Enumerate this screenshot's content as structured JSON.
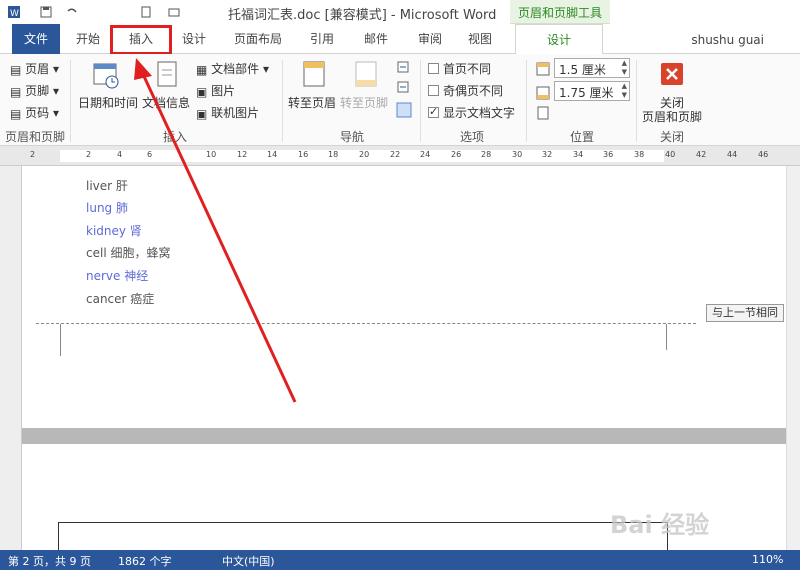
{
  "window": {
    "title": "托福词汇表.doc [兼容模式] - Microsoft Word",
    "context_tool": "页眉和页脚工具"
  },
  "tabs": [
    "文件",
    "开始",
    "插入",
    "设计",
    "页面布局",
    "引用",
    "邮件",
    "审阅",
    "视图",
    "设计"
  ],
  "user": "shushu guai",
  "ribbon": {
    "hf_group": {
      "header": "页眉",
      "footer": "页脚",
      "page_num": "页码",
      "label": "页眉和页脚"
    },
    "insert_group": {
      "datetime": "日期和时间",
      "docinfo": "文档信息",
      "docparts": "文档部件",
      "picture": "图片",
      "online_picture": "联机图片",
      "label": "插入"
    },
    "nav_group": {
      "goto_header": "转至页眉",
      "goto_footer": "转至页脚",
      "label": "导航"
    },
    "options_group": {
      "first_page": "首页不同",
      "odd_even": "奇偶页不同",
      "show_text": "显示文档文字",
      "label": "选项"
    },
    "position_group": {
      "header_pos": "1.5 厘米",
      "footer_pos": "1.75 厘米",
      "label": "位置"
    },
    "close_group": {
      "close": "关闭",
      "close2": "页眉和页脚",
      "label": "关闭"
    }
  },
  "ruler": {
    "numbers": [
      "2",
      "2",
      "4",
      "6",
      "10",
      "12",
      "14",
      "16",
      "18",
      "20",
      "22",
      "24",
      "26",
      "28",
      "30",
      "32",
      "34",
      "36",
      "38",
      "40",
      "42",
      "44",
      "46"
    ]
  },
  "document": {
    "words": [
      {
        "text": "liver  肝",
        "blue": false
      },
      {
        "text": "lung  肺",
        "blue": true
      },
      {
        "text": "kidney  肾",
        "blue": true
      },
      {
        "text": "cell  细胞，蜂窝",
        "blue": false
      },
      {
        "text": "nerve  神经",
        "blue": true
      },
      {
        "text": "cancer  癌症",
        "blue": false
      }
    ],
    "header_tag": "与上一节相同"
  },
  "status": {
    "page": "第 2 页，共 9 页",
    "words": "1862 个字",
    "lang": "中文(中国)",
    "zoom": "110%"
  },
  "watermark": "Bai 经验",
  "colors": {
    "file_tab": "#2b579a",
    "context": "#2a8a22",
    "highlight": "#e02020",
    "blue_word": "#5d6ad6"
  }
}
